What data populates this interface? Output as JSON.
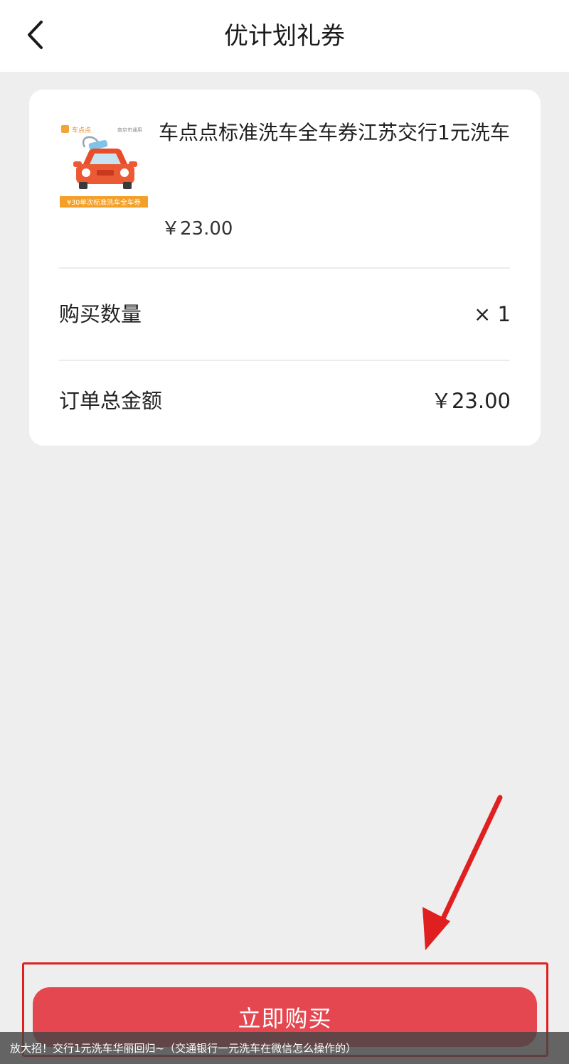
{
  "header": {
    "title": "优计划礼券",
    "back_icon": "chevron-left-icon"
  },
  "product": {
    "name": "车点点标准洗车全车券江苏交行1元洗车",
    "price": "￥23.00",
    "thumbnail": {
      "brand": "车点点",
      "region": "南京市通用",
      "badge": "¥30单次标准洗车全车券"
    }
  },
  "order": {
    "quantity_label": "购买数量",
    "quantity_value": "× 1",
    "total_label": "订单总金额",
    "total_value": "￥23.00"
  },
  "footer": {
    "buy_label": "立即购买"
  },
  "caption": {
    "text": "放大招！交行1元洗车华丽回归~（交通银行一元洗车在微信怎么操作的）"
  },
  "colors": {
    "accent": "#e4474f",
    "annotation": "#e02020",
    "background": "#eeeeee"
  }
}
